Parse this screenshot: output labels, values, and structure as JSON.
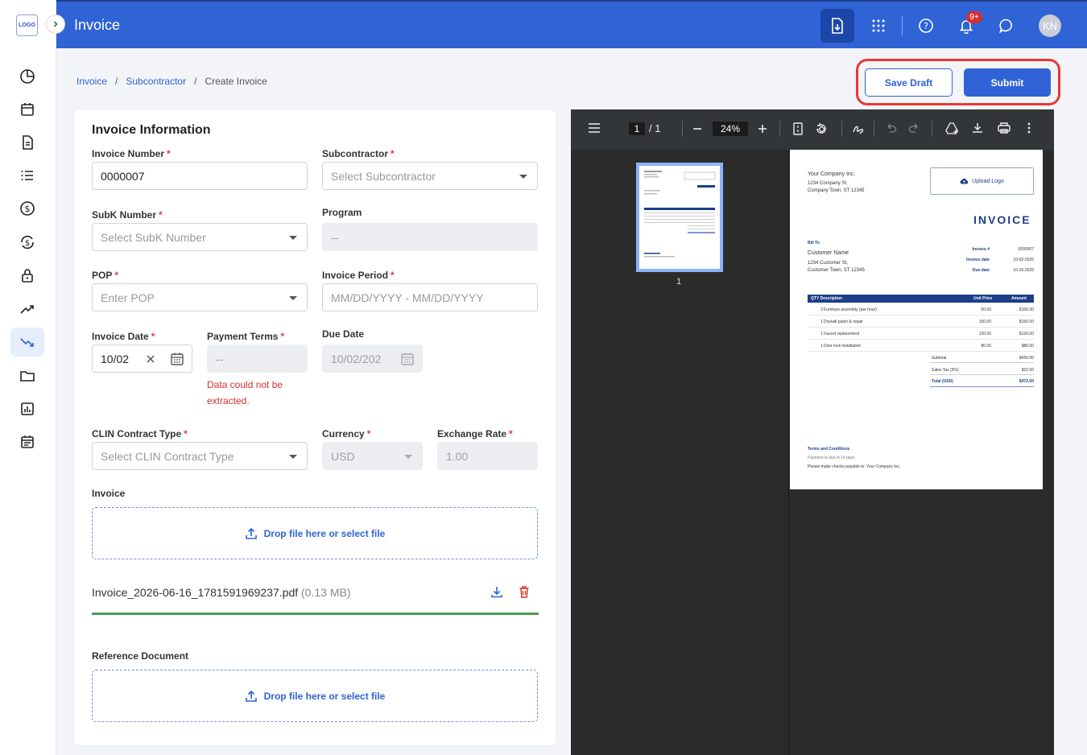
{
  "app": {
    "logo_text": "LOGO",
    "title": "Invoice",
    "user_initials": "KN",
    "notification_count": "9+"
  },
  "sidebar": {
    "items": [
      {
        "icon": "pie-chart-icon"
      },
      {
        "icon": "calendar-icon"
      },
      {
        "icon": "document-icon"
      },
      {
        "icon": "list-icon"
      },
      {
        "icon": "dollar-icon"
      },
      {
        "icon": "dollar-cycle-icon"
      },
      {
        "icon": "lock-icon"
      },
      {
        "icon": "trending-up-icon"
      },
      {
        "icon": "trending-down-icon",
        "active": true
      },
      {
        "icon": "folder-icon"
      },
      {
        "icon": "report-icon"
      },
      {
        "icon": "schedule-icon"
      }
    ]
  },
  "breadcrumb": {
    "level1": "Invoice",
    "level2": "Subcontractor",
    "current": "Create Invoice",
    "separator": "/"
  },
  "actions": {
    "save_draft": "Save Draft",
    "submit": "Submit"
  },
  "form": {
    "title": "Invoice Information",
    "invoice_number": {
      "label": "Invoice Number",
      "value": "0000007"
    },
    "subcontractor": {
      "label": "Subcontractor",
      "placeholder": "Select Subcontractor"
    },
    "subk_number": {
      "label": "SubK Number",
      "placeholder": "Select SubK Number"
    },
    "program": {
      "label": "Program",
      "value": "--"
    },
    "pop": {
      "label": "POP",
      "placeholder": "Enter POP"
    },
    "invoice_period": {
      "label": "Invoice Period",
      "placeholder": "MM/DD/YYYY - MM/DD/YYYY"
    },
    "invoice_date": {
      "label": "Invoice Date",
      "value": "10/02"
    },
    "payment_terms": {
      "label": "Payment Terms",
      "value": "--",
      "error": "Data could not be extracted."
    },
    "due_date": {
      "label": "Due Date",
      "value": "10/02/202"
    },
    "clin_contract_type": {
      "label": "CLIN Contract Type",
      "placeholder": "Select CLIN Contract Type"
    },
    "currency": {
      "label": "Currency",
      "value": "USD"
    },
    "exchange_rate": {
      "label": "Exchange Rate",
      "value": "1.00"
    },
    "invoice_upload": {
      "label": "Invoice",
      "dropzone": "Drop file here or select file"
    },
    "uploaded_file": {
      "name": "Invoice_2026-06-16_1781591969237.pdf",
      "size": "(0.13 MB)"
    },
    "reference_upload": {
      "label": "Reference Document",
      "dropzone": "Drop file here or select file"
    }
  },
  "pdf_viewer": {
    "page_current": "1",
    "page_total": "/ 1",
    "zoom": "24%",
    "thumbnail_label": "1",
    "document": {
      "company_name": "Your Company Inc.",
      "company_street": "1234 Company St,",
      "company_city": "Company Town, ST 12345",
      "upload_logo": "Upload Logo",
      "heading": "INVOICE",
      "bill_to_label": "Bill To",
      "customer_name": "Customer Name",
      "customer_street": "1234 Customer St,",
      "customer_city": "Customer Town, ST 12345",
      "meta": [
        {
          "label": "Invoice #",
          "value": "0000007"
        },
        {
          "label": "Invoice date",
          "value": "10-02-2025"
        },
        {
          "label": "Due date",
          "value": "10-16-2025"
        }
      ],
      "table_headers": {
        "qty_desc": "QTY  Description",
        "unit_price": "Unit Price",
        "amount": "Amount"
      },
      "rows": [
        {
          "qty": "2",
          "desc": "Furniture assembly (per hour)",
          "unit": "50.00",
          "amount": "$100.00"
        },
        {
          "qty": "1",
          "desc": "Drywall patch & repair",
          "unit": "150.00",
          "amount": "$150.00"
        },
        {
          "qty": "1",
          "desc": "Faucet replacement",
          "unit": "120.00",
          "amount": "$120.00"
        },
        {
          "qty": "1",
          "desc": "Door lock installation",
          "unit": "80.00",
          "amount": "$80.00"
        }
      ],
      "subtotal_label": "Subtotal",
      "subtotal": "$450.00",
      "tax_label": "Sales Tax (5%)",
      "tax": "$22.50",
      "total_label": "Total (USD)",
      "total": "$472.50",
      "terms_title": "Terms and Conditions",
      "terms_line1": "Payment is due in 14 days",
      "terms_line2": "Please make checks payable to: Your Company Inc."
    }
  },
  "colors": {
    "primary": "#2f63d6",
    "error": "#d32f2f",
    "success": "#4f9a53",
    "highlight_ring": "#e53935"
  }
}
